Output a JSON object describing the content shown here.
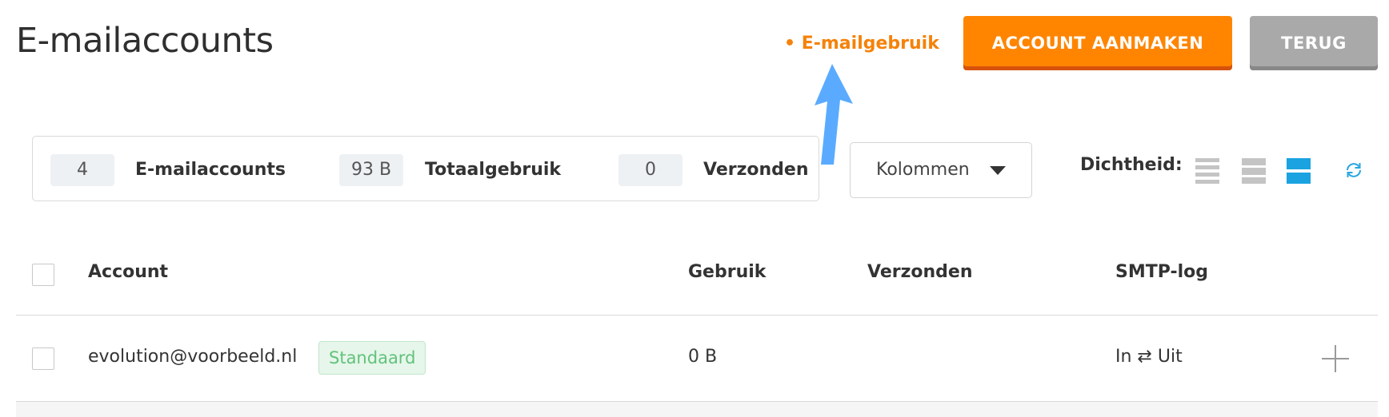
{
  "header": {
    "title": "E-mailaccounts",
    "usage_link": "• E-mailgebruik",
    "create_button": "ACCOUNT AANMAKEN",
    "back_button": "TERUG"
  },
  "stats": [
    {
      "count": "4",
      "label": "E-mailaccounts"
    },
    {
      "count": "93 B",
      "label": "Totaalgebruik"
    },
    {
      "count": "0",
      "label": "Verzonden"
    }
  ],
  "toolbar": {
    "columns_label": "Kolommen",
    "density_label": "Dichtheid:",
    "density_options": [
      "compact-icon",
      "normal-icon",
      "spacious-icon"
    ],
    "density_selected": 2
  },
  "table": {
    "columns": [
      "Account",
      "Gebruik",
      "Verzonden",
      "SMTP-log"
    ],
    "rows": [
      {
        "account": "evolution@voorbeeld.nl",
        "badge": "Standaard",
        "usage": "0 B",
        "sent": "",
        "smtp_log": "In ⇄ Uit"
      }
    ]
  },
  "colors": {
    "accent": "#ff8500",
    "secondary": "#a9a9a9",
    "density_active": "#1aa3e0",
    "badge_text": "#62c27c",
    "annotation_arrow": "#5aabff"
  }
}
